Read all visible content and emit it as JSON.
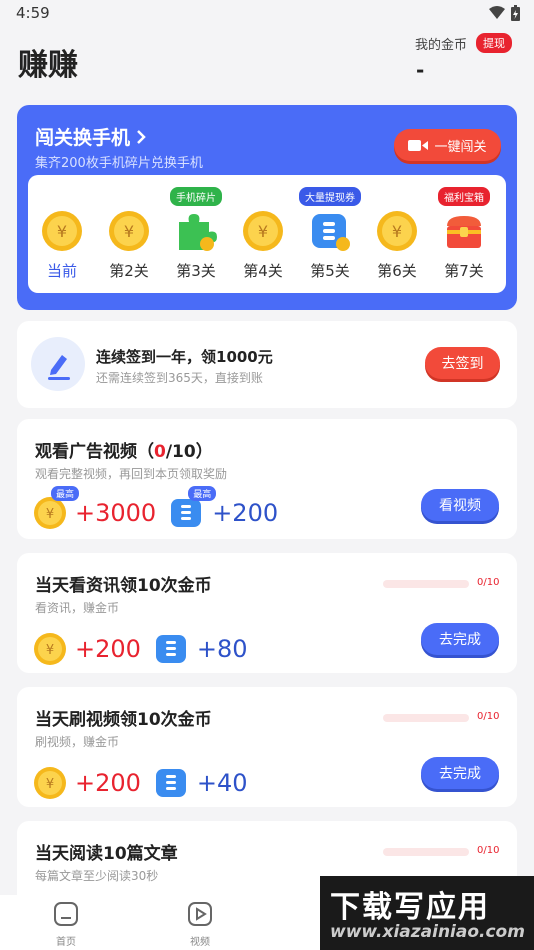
{
  "status": {
    "time": "4:59"
  },
  "header": {
    "title": "赚赚",
    "coin_label": "我的金币",
    "withdraw_label": "提现",
    "coin_value": "-"
  },
  "level_card": {
    "title": "闯关换手机",
    "subtitle": "集齐200枚手机碎片兑换手机",
    "oneclick_label": "一键闯关",
    "levels": [
      {
        "label": "当前",
        "tag": "",
        "icon": "coin-icon"
      },
      {
        "label": "第2关",
        "tag": "",
        "icon": "coin-icon"
      },
      {
        "label": "第3关",
        "tag": "手机碎片",
        "icon": "puzzle-piece-icon"
      },
      {
        "label": "第4关",
        "tag": "",
        "icon": "coin-icon"
      },
      {
        "label": "第5关",
        "tag": "大量提现券",
        "icon": "voucher-icon"
      },
      {
        "label": "第6关",
        "tag": "",
        "icon": "coin-icon"
      },
      {
        "label": "第7关",
        "tag": "福利宝箱",
        "icon": "treasure-chest-icon"
      }
    ]
  },
  "signin": {
    "title": "连续签到一年，领1000元",
    "subtitle": "还需连续签到365天，直接到账",
    "button": "去签到"
  },
  "tasks": [
    {
      "title_prefix": "观看广告视频（",
      "title_count": "0",
      "title_suffix": "/10）",
      "subtitle": "观看完整视频，再回到本页领取奖励",
      "coin_tag": "最高",
      "coins": "+3000",
      "voucher_tag": "最高",
      "vouchers": "+200",
      "button": "看视频"
    },
    {
      "title": "当天看资讯领10次金币",
      "subtitle": "看资讯，赚金币",
      "coins": "+200",
      "vouchers": "+80",
      "progress": "0/10",
      "progress_value": 0,
      "button": "去完成"
    },
    {
      "title": "当天刷视频领10次金币",
      "subtitle": "刷视频，赚金币",
      "coins": "+200",
      "vouchers": "+40",
      "progress": "0/10",
      "progress_value": 0,
      "button": "去完成"
    },
    {
      "title": "当天阅读10篇文章",
      "subtitle": "每篇文章至少阅读30秒",
      "progress": "0/10",
      "progress_value": 0
    }
  ],
  "nav": {
    "home": "首页",
    "video": "视频"
  },
  "watermark": {
    "title": "下载写应用",
    "url": "www.xiazainiao.com"
  },
  "colors": {
    "accent_blue": "#4a6cf7",
    "accent_red": "#f24a3a",
    "coin_gold": "#f5b81c"
  }
}
